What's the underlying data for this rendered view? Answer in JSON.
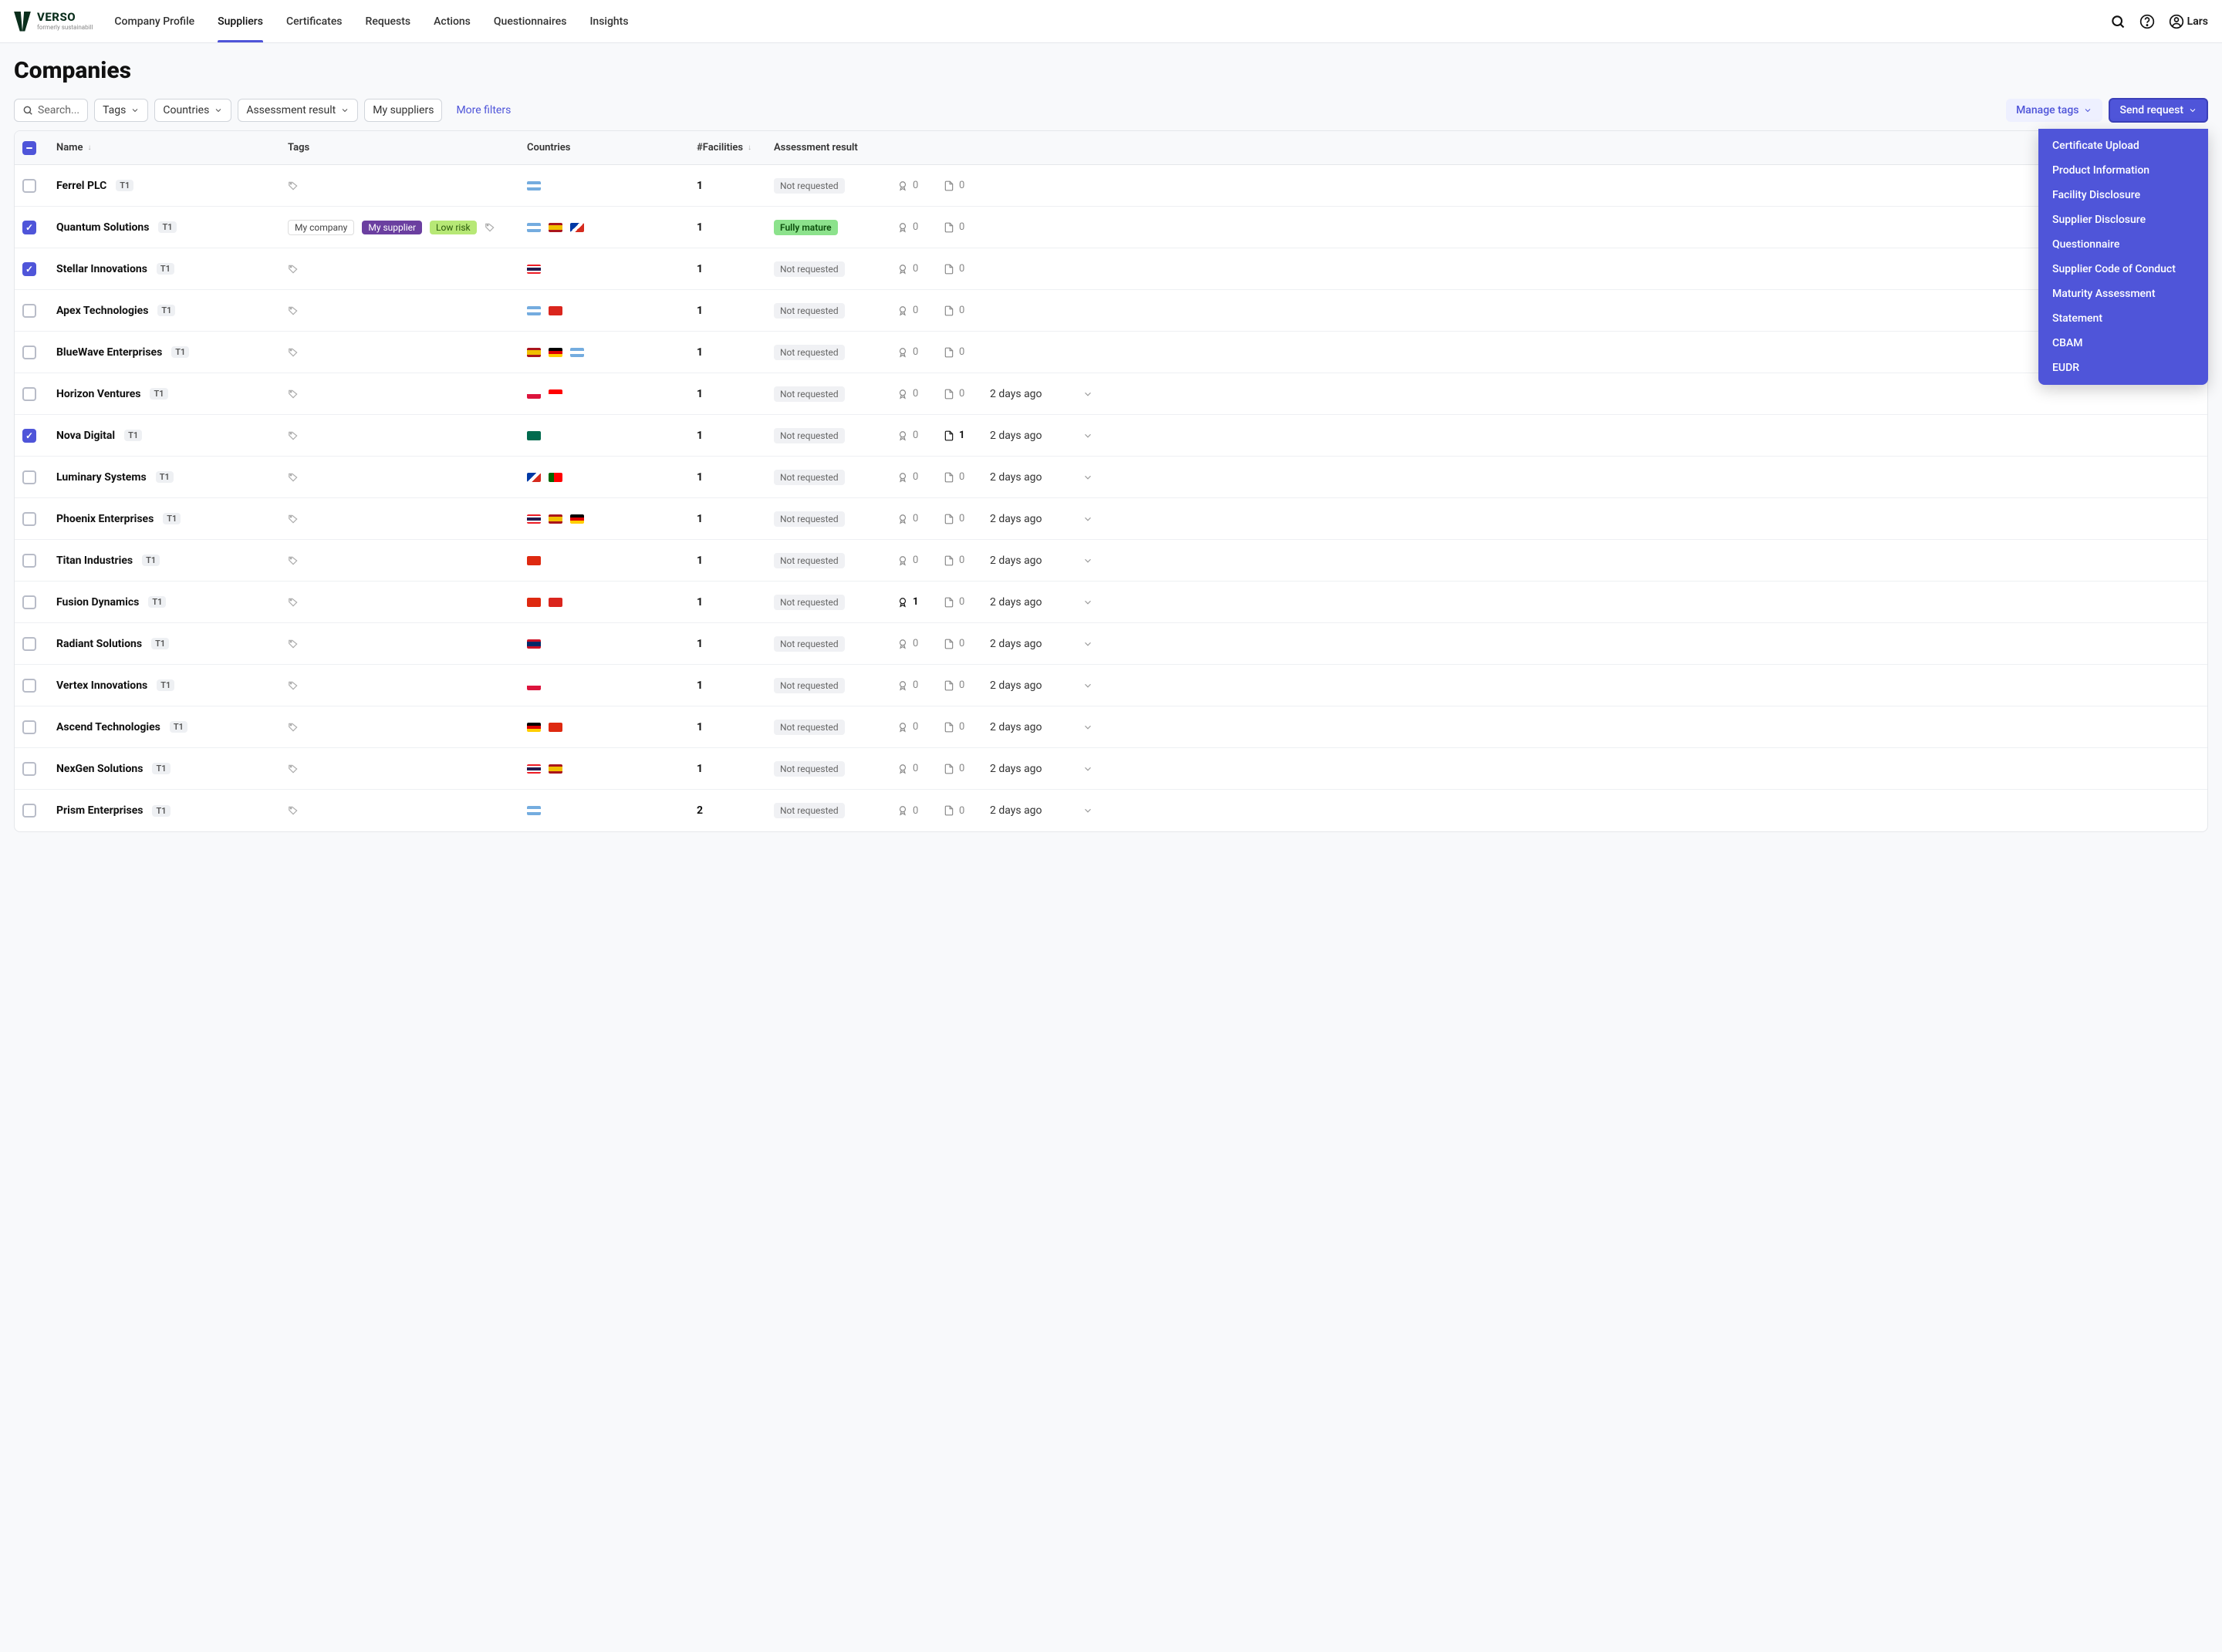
{
  "brand": {
    "name": "VERSO",
    "tagline": "formerly sustainabill"
  },
  "nav": {
    "items": [
      "Company Profile",
      "Suppliers",
      "Certificates",
      "Requests",
      "Actions",
      "Questionnaires",
      "Insights"
    ],
    "active": "Suppliers"
  },
  "user": {
    "name": "Lars"
  },
  "page": {
    "title": "Companies"
  },
  "filters": {
    "search_placeholder": "Search...",
    "tags": "Tags",
    "countries": "Countries",
    "assessment": "Assessment result",
    "mysuppliers": "My suppliers",
    "more": "More filters"
  },
  "actions": {
    "manage": "Manage tags",
    "send": "Send request",
    "send_menu": [
      "Certificate Upload",
      "Product Information",
      "Facility Disclosure",
      "Supplier Disclosure",
      "Questionnaire",
      "Supplier Code of Conduct",
      "Maturity Assessment",
      "Statement",
      "CBAM",
      "EUDR"
    ]
  },
  "columns": [
    "Name",
    "Tags",
    "Countries",
    "#Facilities",
    "Assessment result"
  ],
  "rows": [
    {
      "checked": false,
      "name": "Ferrel PLC",
      "tier": "T1",
      "tags": [],
      "flags": [
        "ar"
      ],
      "facilities": "1",
      "assessment": "Not requested",
      "assessClass": "not",
      "cert": 0,
      "doc": 0,
      "age": "",
      "certStrong": false
    },
    {
      "checked": true,
      "name": "Quantum Solutions",
      "tier": "T1",
      "tags": [
        "My company",
        "My supplier",
        "Low risk"
      ],
      "flags": [
        "ar",
        "es",
        "cl"
      ],
      "facilities": "1",
      "assessment": "Fully mature",
      "assessClass": "mature",
      "cert": 0,
      "doc": 0,
      "age": "",
      "certStrong": false,
      "tagAdd": true
    },
    {
      "checked": true,
      "name": "Stellar Innovations",
      "tier": "T1",
      "tags": [],
      "flags": [
        "th"
      ],
      "facilities": "1",
      "assessment": "Not requested",
      "assessClass": "not",
      "cert": 0,
      "doc": 0,
      "age": "",
      "certStrong": false
    },
    {
      "checked": false,
      "name": "Apex Technologies",
      "tier": "T1",
      "tags": [],
      "flags": [
        "ar",
        "vn"
      ],
      "facilities": "1",
      "assessment": "Not requested",
      "assessClass": "not",
      "cert": 0,
      "doc": 0,
      "age": "",
      "certStrong": false
    },
    {
      "checked": false,
      "name": "BlueWave Enterprises",
      "tier": "T1",
      "tags": [],
      "flags": [
        "es",
        "de",
        "ar"
      ],
      "facilities": "1",
      "assessment": "Not requested",
      "assessClass": "not",
      "cert": 0,
      "doc": 0,
      "age": "",
      "certStrong": false
    },
    {
      "checked": false,
      "name": "Horizon Ventures",
      "tier": "T1",
      "tags": [],
      "flags": [
        "pl",
        "id"
      ],
      "facilities": "1",
      "assessment": "Not requested",
      "assessClass": "not",
      "cert": 0,
      "doc": 0,
      "age": "2 days ago",
      "certStrong": false
    },
    {
      "checked": true,
      "name": "Nova Digital",
      "tier": "T1",
      "tags": [],
      "flags": [
        "bd"
      ],
      "facilities": "1",
      "assessment": "Not requested",
      "assessClass": "not",
      "cert": 0,
      "doc": 1,
      "age": "2 days ago",
      "certStrong": false,
      "docStrong": true
    },
    {
      "checked": false,
      "name": "Luminary Systems",
      "tier": "T1",
      "tags": [],
      "flags": [
        "cl",
        "pt"
      ],
      "facilities": "1",
      "assessment": "Not requested",
      "assessClass": "not",
      "cert": 0,
      "doc": 0,
      "age": "2 days ago",
      "certStrong": false
    },
    {
      "checked": false,
      "name": "Phoenix Enterprises",
      "tier": "T1",
      "tags": [],
      "flags": [
        "th",
        "es",
        "de"
      ],
      "facilities": "1",
      "assessment": "Not requested",
      "assessClass": "not",
      "cert": 0,
      "doc": 0,
      "age": "2 days ago",
      "certStrong": false
    },
    {
      "checked": false,
      "name": "Titan Industries",
      "tier": "T1",
      "tags": [],
      "flags": [
        "cn"
      ],
      "facilities": "1",
      "assessment": "Not requested",
      "assessClass": "not",
      "cert": 0,
      "doc": 0,
      "age": "2 days ago",
      "certStrong": false
    },
    {
      "checked": false,
      "name": "Fusion Dynamics",
      "tier": "T1",
      "tags": [],
      "flags": [
        "cn",
        "vn"
      ],
      "facilities": "1",
      "assessment": "Not requested",
      "assessClass": "not",
      "cert": 1,
      "doc": 0,
      "age": "2 days ago",
      "certStrong": true
    },
    {
      "checked": false,
      "name": "Radiant Solutions",
      "tier": "T1",
      "tags": [],
      "flags": [
        "la"
      ],
      "facilities": "1",
      "assessment": "Not requested",
      "assessClass": "not",
      "cert": 0,
      "doc": 0,
      "age": "2 days ago",
      "certStrong": false
    },
    {
      "checked": false,
      "name": "Vertex Innovations",
      "tier": "T1",
      "tags": [],
      "flags": [
        "pl"
      ],
      "facilities": "1",
      "assessment": "Not requested",
      "assessClass": "not",
      "cert": 0,
      "doc": 0,
      "age": "2 days ago",
      "certStrong": false
    },
    {
      "checked": false,
      "name": "Ascend Technologies",
      "tier": "T1",
      "tags": [],
      "flags": [
        "de",
        "cn"
      ],
      "facilities": "1",
      "assessment": "Not requested",
      "assessClass": "not",
      "cert": 0,
      "doc": 0,
      "age": "2 days ago",
      "certStrong": false
    },
    {
      "checked": false,
      "name": "NexGen Solutions",
      "tier": "T1",
      "tags": [],
      "flags": [
        "th",
        "es"
      ],
      "facilities": "1",
      "assessment": "Not requested",
      "assessClass": "not",
      "cert": 0,
      "doc": 0,
      "age": "2 days ago",
      "certStrong": false
    },
    {
      "checked": false,
      "name": "Prism Enterprises",
      "tier": "T1",
      "tags": [],
      "flags": [
        "ar"
      ],
      "facilities": "2",
      "assessment": "Not requested",
      "assessClass": "not",
      "cert": 0,
      "doc": 0,
      "age": "2 days ago",
      "certStrong": false
    }
  ]
}
